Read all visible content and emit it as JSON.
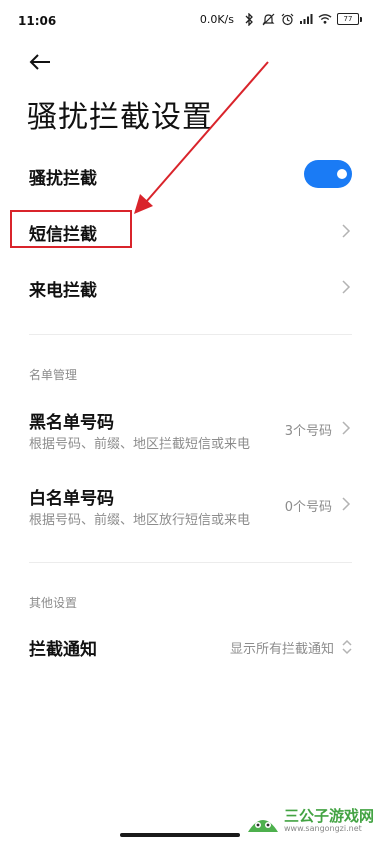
{
  "status_bar": {
    "time": "11:06",
    "speed": "0.0K/s",
    "battery_level": "77"
  },
  "page": {
    "title": "骚扰拦截设置"
  },
  "settings": {
    "harassment_block": {
      "label": "骚扰拦截",
      "enabled": true
    },
    "sms_block": {
      "label": "短信拦截"
    },
    "call_block": {
      "label": "来电拦截"
    }
  },
  "list_management": {
    "header": "名单管理",
    "blacklist": {
      "label": "黑名单号码",
      "subtitle": "根据号码、前缀、地区拦截短信或来电",
      "value": "3个号码"
    },
    "whitelist": {
      "label": "白名单号码",
      "subtitle": "根据号码、前缀、地区放行短信或来电",
      "value": "0个号码"
    }
  },
  "other_settings": {
    "header": "其他设置",
    "block_notification": {
      "label": "拦截通知",
      "value": "显示所有拦截通知"
    }
  },
  "annotation": {
    "highlight_color": "#d9242b"
  },
  "watermark": {
    "name": "三公子游戏网",
    "url": "www.sangongzi.net"
  },
  "colors": {
    "accent": "#1a7bf5",
    "secondary_text": "#8c8c8c",
    "watermark_green": "#2f9a2f"
  }
}
